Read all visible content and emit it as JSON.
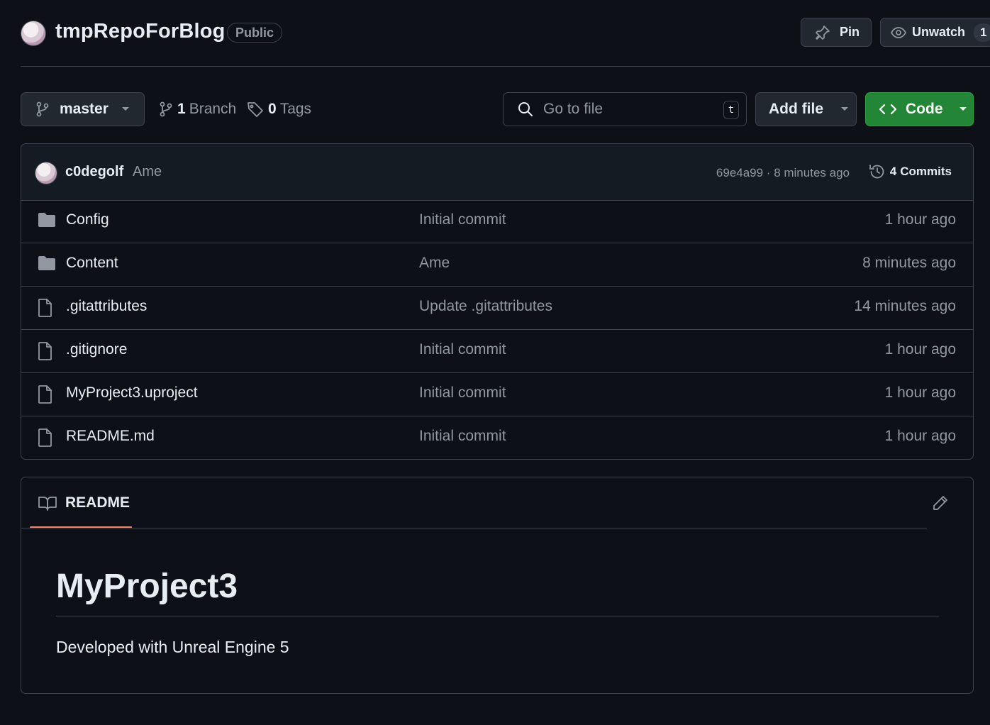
{
  "repo": {
    "name": "tmpRepoForBlog",
    "visibility": "Public"
  },
  "header_actions": {
    "pin_label": "Pin",
    "unwatch_label": "Unwatch",
    "watch_count": "1"
  },
  "toolbar": {
    "branch": "master",
    "branches_count": "1",
    "branches_label": "Branch",
    "tags_count": "0",
    "tags_label": "Tags",
    "search_placeholder": "Go to file",
    "search_shortcut": "t",
    "add_file_label": "Add file",
    "code_label": "Code"
  },
  "latest_commit": {
    "author": "c0degolf",
    "message": "Ame",
    "hash_time": "69e4a99 · 8 minutes ago",
    "commits_count": "4",
    "commits_label": "Commits"
  },
  "files": [
    {
      "name": "Config",
      "type": "folder",
      "message": "Initial commit",
      "time": "1 hour ago"
    },
    {
      "name": "Content",
      "type": "folder",
      "message": "Ame",
      "time": "8 minutes ago"
    },
    {
      "name": ".gitattributes",
      "type": "file",
      "message": "Update .gitattributes",
      "time": "14 minutes ago"
    },
    {
      "name": ".gitignore",
      "type": "file",
      "message": "Initial commit",
      "time": "1 hour ago"
    },
    {
      "name": "MyProject3.uproject",
      "type": "file",
      "message": "Initial commit",
      "time": "1 hour ago"
    },
    {
      "name": "README.md",
      "type": "file",
      "message": "Initial commit",
      "time": "1 hour ago"
    }
  ],
  "readme": {
    "tab_label": "README",
    "heading": "MyProject3",
    "body": "Developed with Unreal Engine 5"
  },
  "colors": {
    "background": "#0d1117",
    "border": "#3d444d",
    "code_button": "#238636",
    "tab_underline": "#f78166",
    "muted_text": "#9198a1"
  },
  "icons": {
    "repo_avatar": "avatar",
    "pin": "pin-icon",
    "unwatch": "eye-icon",
    "branch": "git-branch-icon",
    "tag": "tag-icon",
    "search": "search-icon",
    "code": "code-icon",
    "history": "history-icon",
    "folder": "folder-icon",
    "file": "file-icon",
    "book": "book-icon",
    "edit": "pencil-icon"
  }
}
